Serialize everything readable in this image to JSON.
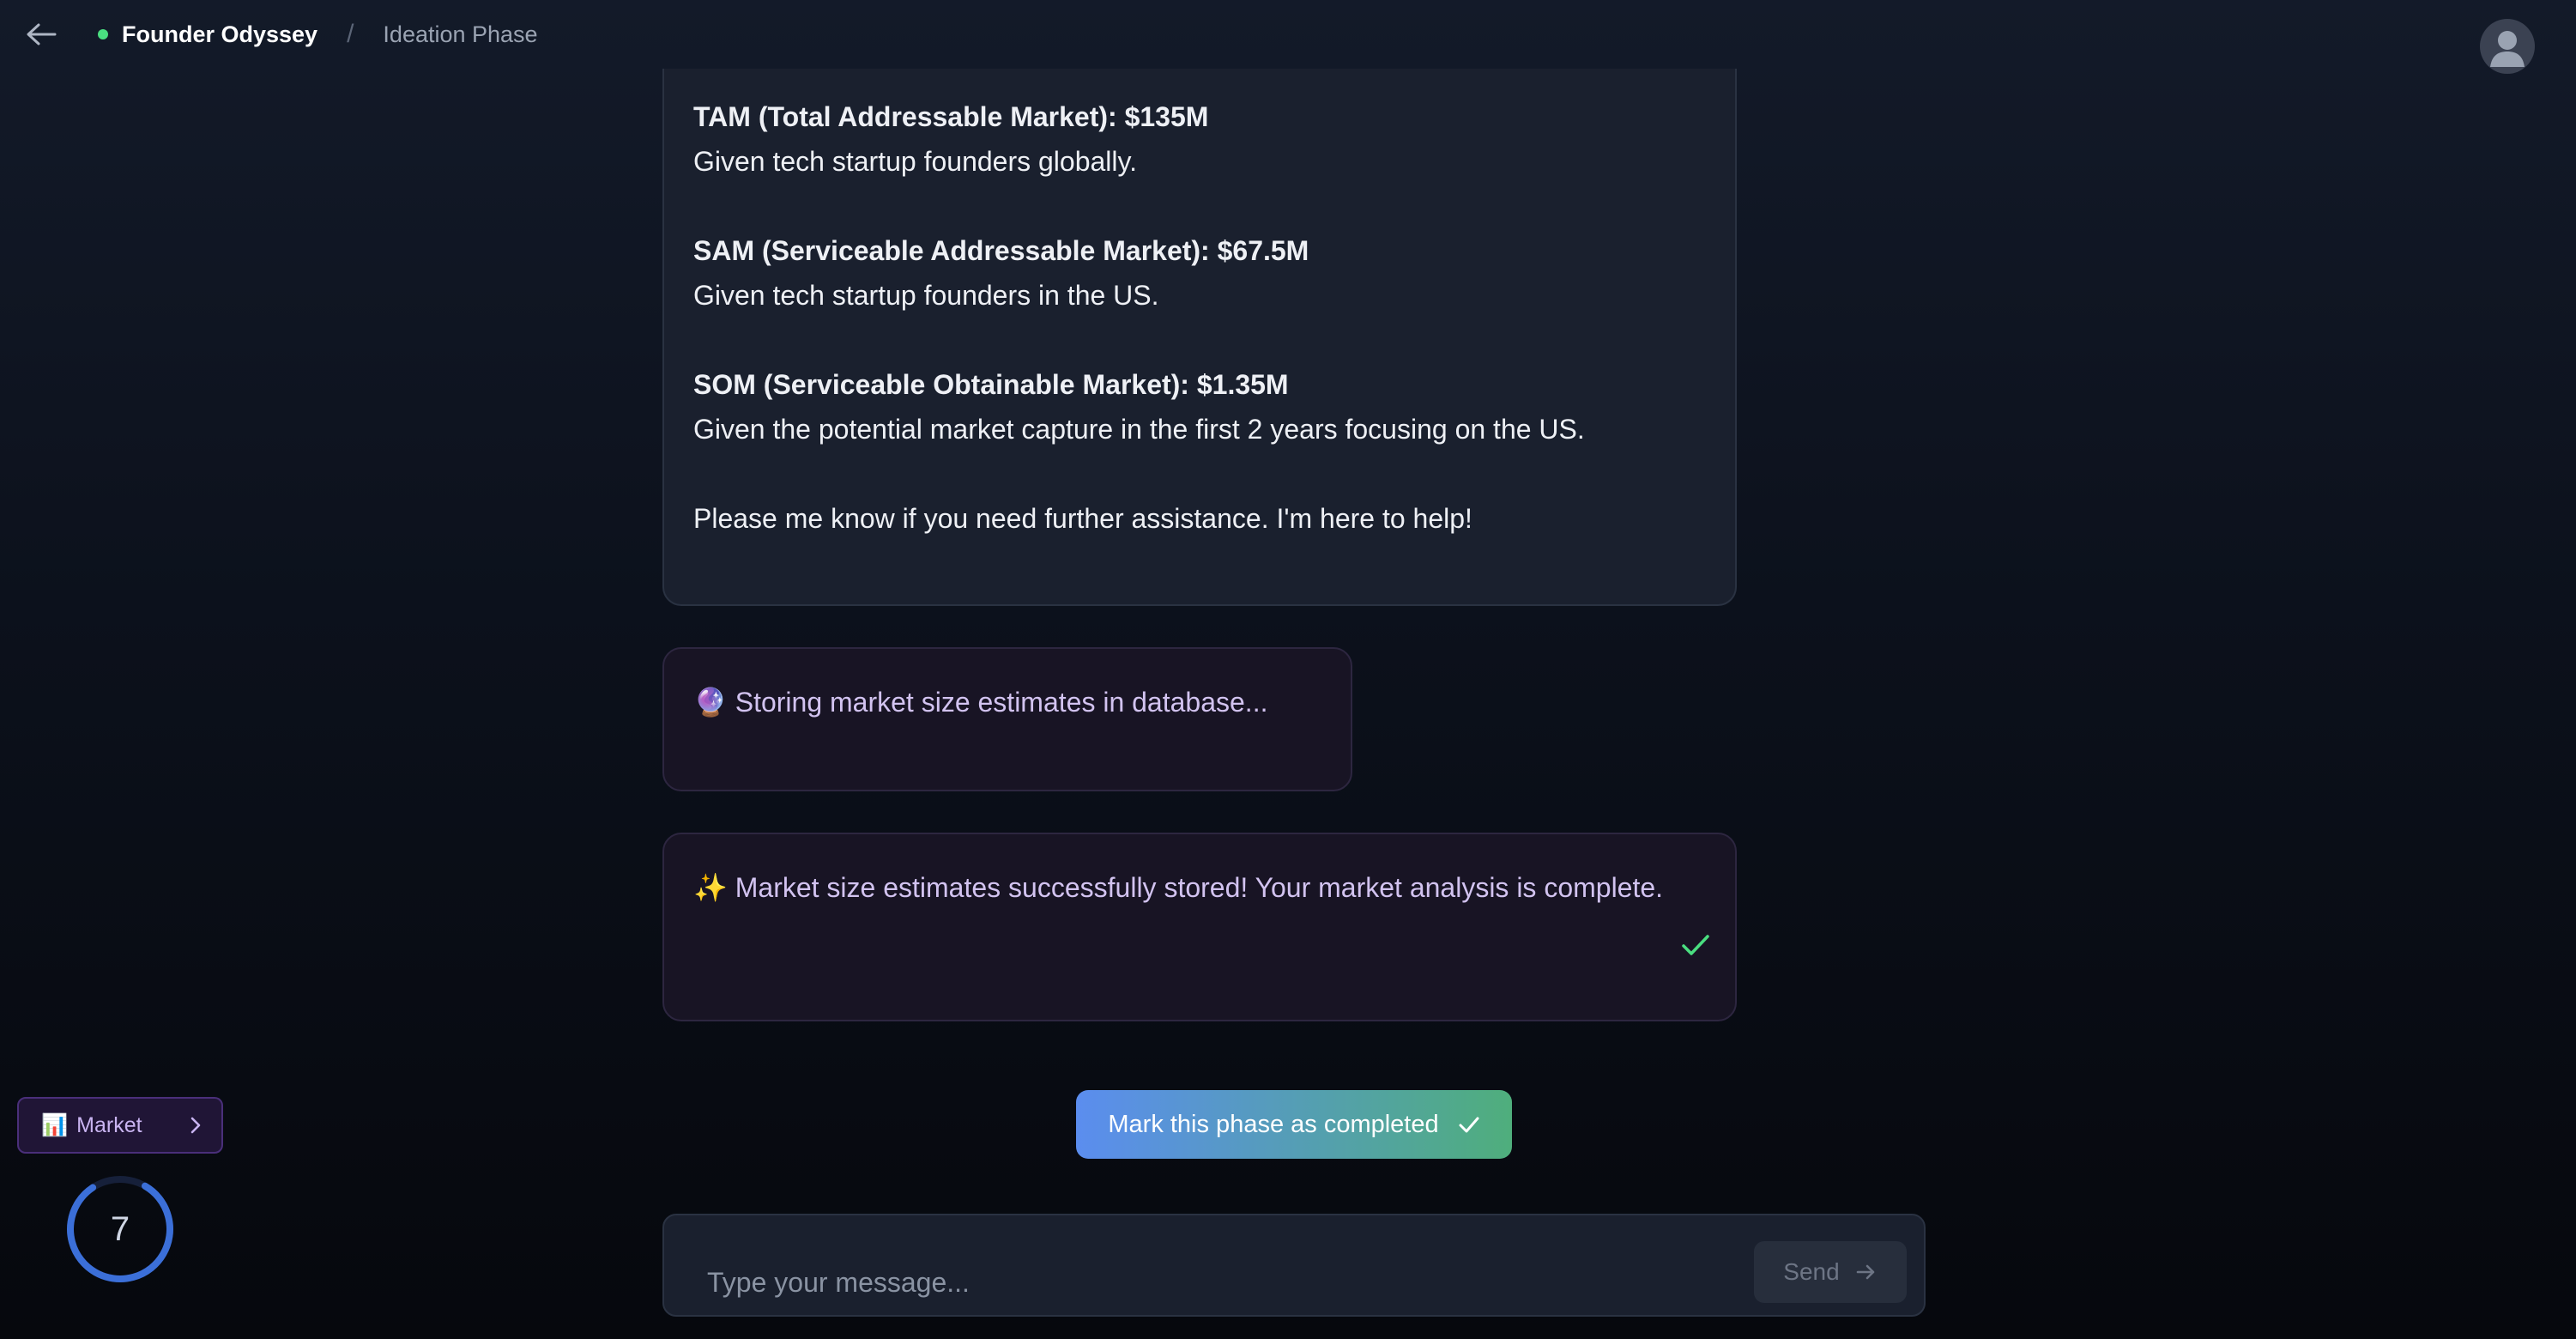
{
  "header": {
    "app_name": "Founder Odyssey",
    "separator": "/",
    "phase": "Ideation Phase"
  },
  "ai_message": {
    "tam_title": "TAM (Total Addressable Market): $135M",
    "tam_desc": "Given tech startup founders globally.",
    "sam_title": "SAM (Serviceable Addressable Market): $67.5M",
    "sam_desc": "Given tech startup founders in the US.",
    "som_title": "SOM (Serviceable Obtainable Market): $1.35M",
    "som_desc": "Given the potential market capture in the first 2 years focusing on the US.",
    "closing": "Please me know if you need further assistance. I'm here to help!"
  },
  "status_message": {
    "emoji": "🔮",
    "text": "Storing market size estimates in database..."
  },
  "success_message": {
    "emoji": "✨",
    "text": "Market size estimates successfully stored! Your market analysis is complete."
  },
  "complete_button": {
    "label": "Mark this phase as completed"
  },
  "composer": {
    "placeholder": "Type your message...",
    "send_label": "Send"
  },
  "side_widget": {
    "emoji": "📊",
    "label": "Market",
    "count": "7"
  },
  "colors": {
    "accent_green": "#4ade80",
    "accent_purple": "#c9b4f1",
    "ring_blue": "#3b6fd8"
  }
}
